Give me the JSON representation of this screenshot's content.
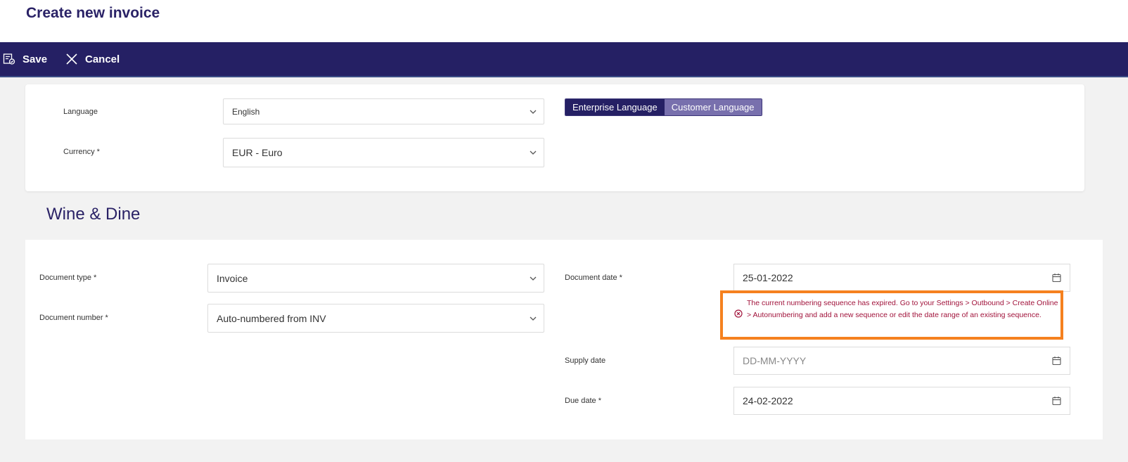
{
  "page": {
    "title": "Create new invoice"
  },
  "toolbar": {
    "save_label": "Save",
    "cancel_label": "Cancel"
  },
  "settings": {
    "language_label": "Language",
    "language_value": "English",
    "currency_label": "Currency *",
    "currency_value": "EUR - Euro",
    "language_toggle": {
      "enterprise": "Enterprise Language",
      "customer": "Customer Language",
      "selected": "enterprise"
    }
  },
  "customer": {
    "name": "Wine & Dine"
  },
  "document": {
    "type_label": "Document type *",
    "type_value": "Invoice",
    "number_label": "Document number *",
    "number_value": "Auto-numbered from INV",
    "date_label": "Document date *",
    "date_value": "25-01-2022",
    "error_message": "The current numbering sequence has expired. Go to your Settings > Outbound > Create Online > Autonumbering and add a new sequence or edit the date range of an existing sequence.",
    "supply_label": "Supply date",
    "supply_placeholder": "DD-MM-YYYY",
    "due_label": "Due date *",
    "due_value": "24-02-2022"
  },
  "colors": {
    "brand": "#252064",
    "error": "#a1133b",
    "highlight": "#f5811f"
  }
}
